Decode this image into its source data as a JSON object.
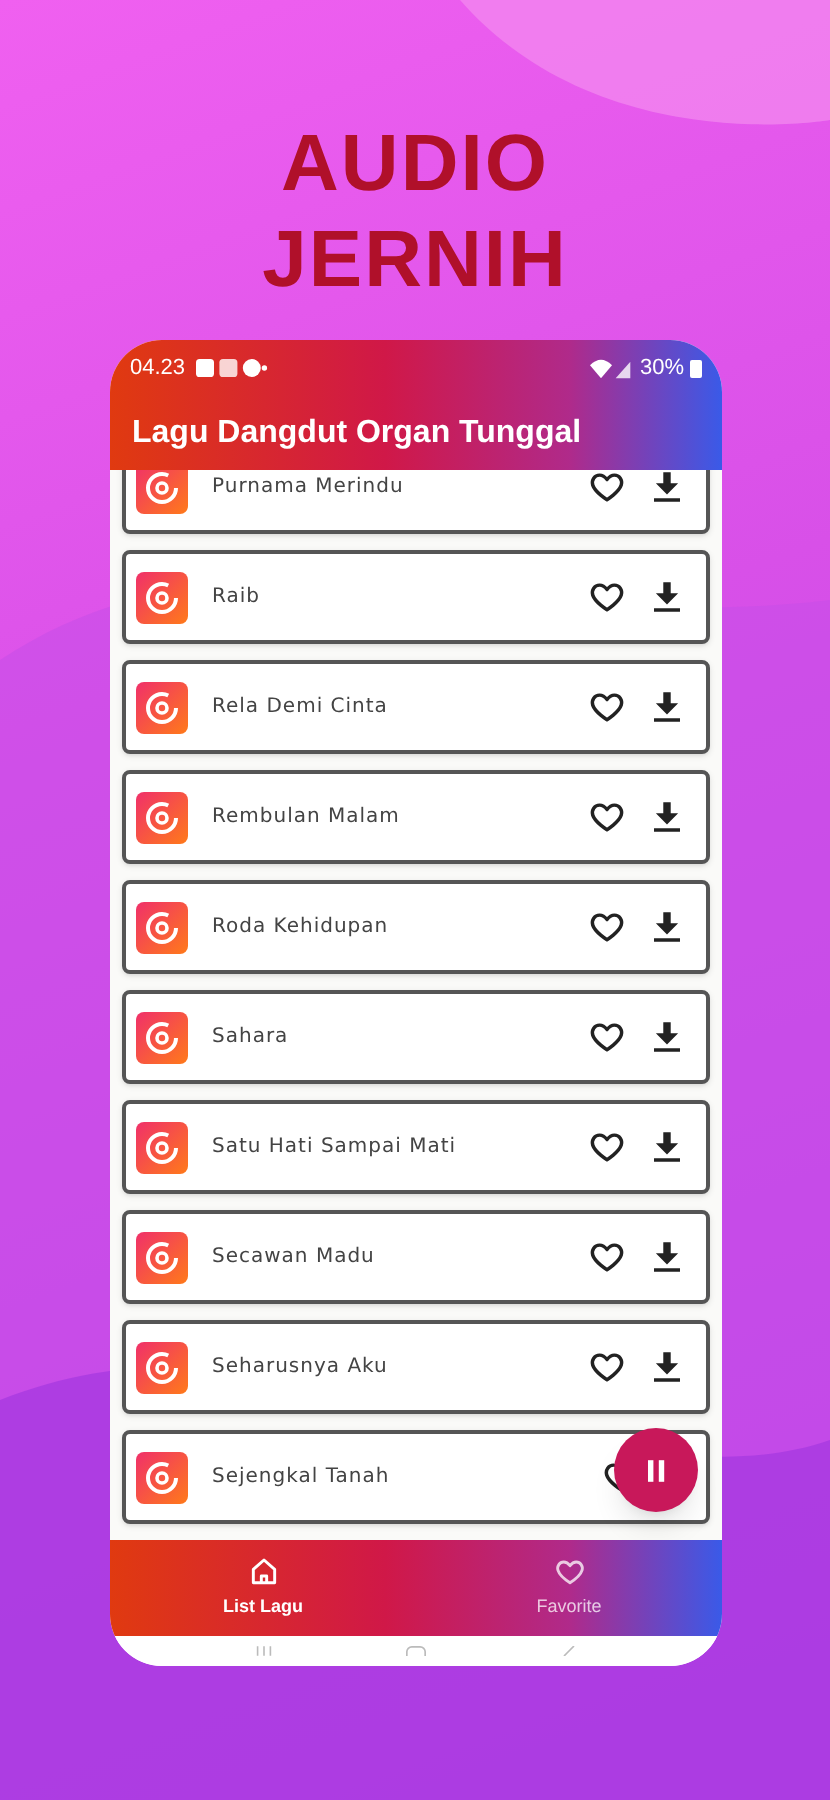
{
  "headline": [
    "AUDIO",
    "JERNIH"
  ],
  "status_bar": {
    "time": "04.23",
    "battery": "30%"
  },
  "app_bar": {
    "title": "Lagu Dangdut Organ Tunggal"
  },
  "songs": [
    {
      "title": "Purnama Merindu",
      "favorite": false
    },
    {
      "title": "Raib",
      "favorite": false
    },
    {
      "title": "Rela Demi Cinta",
      "favorite": false
    },
    {
      "title": "Rembulan Malam",
      "favorite": false
    },
    {
      "title": "Roda Kehidupan",
      "favorite": false
    },
    {
      "title": "Sahara",
      "favorite": false
    },
    {
      "title": "Satu Hati Sampai Mati",
      "favorite": false
    },
    {
      "title": "Secawan Madu",
      "favorite": false
    },
    {
      "title": "Seharusnya Aku",
      "favorite": false
    },
    {
      "title": "Sejengkal Tanah",
      "favorite": false
    }
  ],
  "player": {
    "playing": true
  },
  "nav": [
    {
      "label": "List Lagu",
      "kind": "home",
      "selected": true
    },
    {
      "label": "Favorite",
      "kind": "heart",
      "selected": false
    }
  ]
}
